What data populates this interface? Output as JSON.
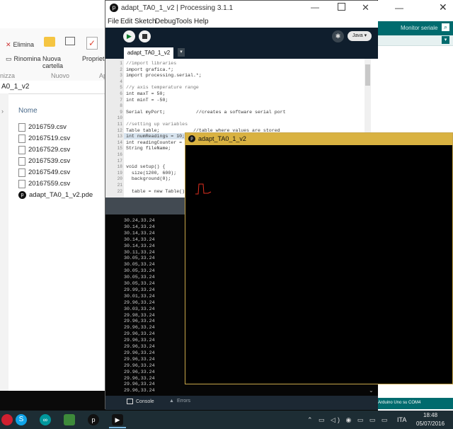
{
  "explorer": {
    "ribbon": {
      "delete_label": "Elimina",
      "rename_label": "Rinomina",
      "new_folder_label": "Nuova cartella",
      "properties_label": "Proprietà",
      "group_organize": "nizza",
      "group_new": "Nuovo",
      "group_open": "Apri"
    },
    "address": "A0_1_v2",
    "column_header": "Nome",
    "files": [
      "2016759.csv",
      "20167519.csv",
      "20167529.csv",
      "20167539.csv",
      "20167549.csv",
      "20167559.csv",
      "adapt_TA0_1_v2.pde"
    ]
  },
  "arduino": {
    "serial_button": "Monitor seriale",
    "status": "Arduino Uno su COM4"
  },
  "processing": {
    "title": "adapt_TA0_1_v2 | Processing 3.1.1",
    "menu": [
      "File",
      "Edit",
      "Sketch",
      "Debug",
      "Tools",
      "Help"
    ],
    "mode": "Java",
    "tab_label": "adapt_TA0_1_v2",
    "code_lines": [
      {
        "n": "1",
        "t": "//import libraries"
      },
      {
        "n": "2",
        "t": "import grafica.*;"
      },
      {
        "n": "3",
        "t": "import processing.serial.*;"
      },
      {
        "n": "4",
        "t": ""
      },
      {
        "n": "5",
        "t": "//y axis temperature range"
      },
      {
        "n": "6",
        "t": "int maxT = 50;"
      },
      {
        "n": "7",
        "t": "int minT = -50;"
      },
      {
        "n": "8",
        "t": ""
      },
      {
        "n": "9",
        "t": "Serial myPort;           //creates a software serial port"
      },
      {
        "n": "10",
        "t": ""
      },
      {
        "n": "11",
        "t": "//setting up variables"
      },
      {
        "n": "12",
        "t": "Table table;            //table where values are stored"
      },
      {
        "n": "13",
        "t": "int numReadings = 10;"
      },
      {
        "n": "14",
        "t": "int readingCounter = 0;"
      },
      {
        "n": "15",
        "t": "String fileName;"
      },
      {
        "n": "16",
        "t": ""
      },
      {
        "n": "17",
        "t": ""
      },
      {
        "n": "18",
        "t": "void setup() {"
      },
      {
        "n": "19",
        "t": "  size(1200, 600);"
      },
      {
        "n": "20",
        "t": "  background(0);"
      },
      {
        "n": "21",
        "t": ""
      },
      {
        "n": "22",
        "t": "  table = new Table();"
      }
    ],
    "console_lines": [
      "30.24,33.24",
      "30.14,33.24",
      "30.14,33.24",
      "30.14,33.24",
      "30.14,33.24",
      "30.11,33.24",
      "30.05,33.24",
      "30.05,33.24",
      "30.05,33.24",
      "30.05,33.24",
      "30.05,33.24",
      "29.99,33.24",
      "30.01,33.24",
      "29.96,33.24",
      "30.03,33.24",
      "29.98,33.24",
      "29.96,33.24",
      "29.96,33.24",
      "29.96,33.24",
      "29.96,33.24",
      "29.96,33.24",
      "29.96,33.24",
      "29.96,33.24",
      "29.96,33.24",
      "29.96,33.24",
      "29.96,33.24",
      "29.96,33.24",
      "29.96,33.24"
    ],
    "console_tab": "Console",
    "errors_tab": "Errors"
  },
  "sketch": {
    "title": "adapt_TA0_1_v2"
  },
  "taskbar": {
    "language": "ITA",
    "time": "18:48",
    "date": "05/07/2016"
  },
  "colors": {
    "processing_dark": "#0f1e2d",
    "arduino_teal": "#006b6e",
    "sketch_title": "#d9b241",
    "plot_line": "#e03020"
  }
}
